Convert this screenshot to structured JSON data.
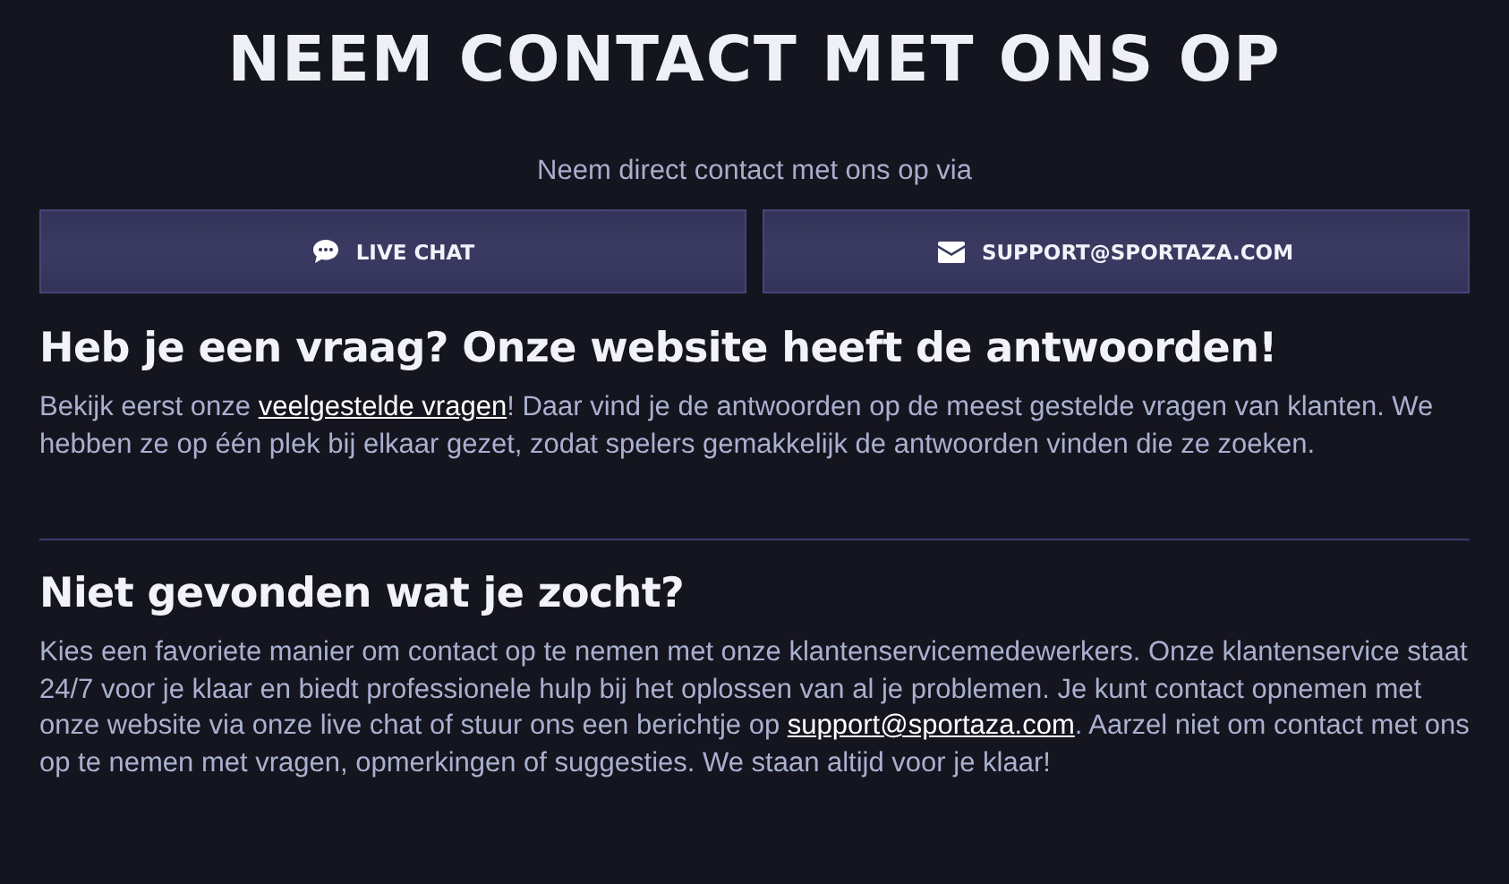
{
  "title": "NEEM CONTACT MET ONS OP",
  "subtitle": "Neem direct contact met ons op via",
  "buttons": [
    {
      "label": "LIVE CHAT",
      "kind": "chat"
    },
    {
      "label": "SUPPORT@SPORTAZA.COM",
      "kind": "mail"
    }
  ],
  "sections": [
    {
      "heading": "Heb je een vraag? Onze website heeft de antwoorden!",
      "paragraph": [
        {
          "kind": "text",
          "text": "Bekijk eerst onze "
        },
        {
          "kind": "link",
          "text": "veelgestelde vragen"
        },
        {
          "kind": "text",
          "text": "! Daar vind je de antwoorden op de meest gestelde vragen van klanten. We hebben ze op één plek bij elkaar gezet, zodat spelers gemakkelijk de antwoorden vinden die ze zoeken."
        }
      ]
    },
    {
      "heading": "Niet gevonden wat je zocht?",
      "paragraph": [
        {
          "kind": "text",
          "text": "Kies een favoriete manier om contact op te nemen met onze klantenservicemedewerkers. Onze klantenservice staat 24/7 voor je klaar en biedt professionele hulp bij het oplossen van al je problemen. Je kunt contact opnemen met onze website via onze live chat of stuur ons een berichtje op "
        },
        {
          "kind": "link",
          "text": "support@sportaza.com"
        },
        {
          "kind": "text",
          "text": ". Aarzel niet om contact met ons op te nemen met vragen, opmerkingen of suggesties. We staan altijd voor je klaar!"
        }
      ]
    }
  ]
}
